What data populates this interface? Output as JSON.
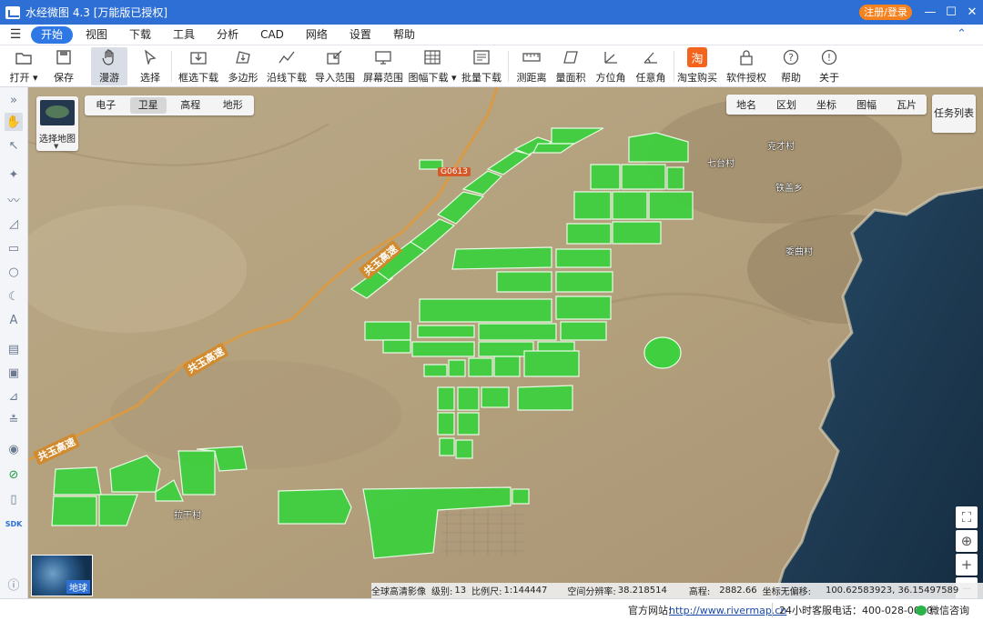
{
  "app": {
    "title": "水经微图 4.3 [万能版已授权]",
    "login_label": "注册/登录",
    "minimize": "—",
    "maximize": "☐",
    "close": "✕"
  },
  "menu": {
    "items": [
      "开始",
      "视图",
      "下载",
      "工具",
      "分析",
      "CAD",
      "网络",
      "设置",
      "帮助"
    ],
    "active": "开始"
  },
  "toolbar": {
    "items": [
      {
        "label": "打开 ▾",
        "icon": "folder-icon"
      },
      {
        "label": "保存",
        "icon": "save-icon"
      },
      {
        "label": "漫游",
        "icon": "hand-icon"
      },
      {
        "label": "选择",
        "icon": "pointer-icon"
      },
      {
        "label": "框选下载",
        "icon": "box-download-icon"
      },
      {
        "label": "多边形",
        "icon": "polygon-download-icon"
      },
      {
        "label": "沿线下载",
        "icon": "line-download-icon"
      },
      {
        "label": "导入范围",
        "icon": "import-range-icon"
      },
      {
        "label": "屏幕范围",
        "icon": "screen-range-icon"
      },
      {
        "label": "图幅下载 ▾",
        "icon": "sheet-download-icon"
      },
      {
        "label": "批量下载",
        "icon": "batch-download-icon"
      },
      {
        "label": "测距离",
        "icon": "ruler-icon"
      },
      {
        "label": "量面积",
        "icon": "area-icon"
      },
      {
        "label": "方位角",
        "icon": "azimuth-icon"
      },
      {
        "label": "任意角",
        "icon": "angle-icon"
      },
      {
        "label": "淘宝购买",
        "icon": "taobao-icon",
        "glyph": "淘"
      },
      {
        "label": "软件授权",
        "icon": "lock-icon"
      },
      {
        "label": "帮助",
        "icon": "help-icon"
      },
      {
        "label": "关于",
        "icon": "info-icon"
      }
    ]
  },
  "leftbar": {
    "items": [
      "collapse-icon",
      "hand-icon",
      "pointer-icon",
      "marker-icon",
      "polyline-icon",
      "area-chart-icon",
      "rectangle-icon",
      "circle-icon",
      "crescent-icon",
      "text-icon",
      "ruler-icon",
      "bus-icon",
      "chart-icon",
      "road-icon",
      "gear-globe-icon",
      "link-icon",
      "phone-icon",
      "sdk-icon",
      "help-icon"
    ],
    "sdk_label": "SDK"
  },
  "map": {
    "type_tabs": [
      "电子",
      "卫星",
      "高程",
      "地形"
    ],
    "active_type": "卫星",
    "select_map_label": "选择地图",
    "layer_tabs": [
      "地名",
      "区划",
      "坐标",
      "图幅",
      "瓦片"
    ],
    "task_list_label": "任务列表",
    "globe_label": "地球",
    "places": [
      "七台村",
      "克才村",
      "铁盖乡",
      "委曲村",
      "拉干村"
    ],
    "road_labels": [
      "共玉高速",
      "共玉高速",
      "共玉高速"
    ],
    "road_badge": "G0613",
    "zoom_buttons": [
      "⛶",
      "⊕",
      "+",
      "−"
    ],
    "status": {
      "source": "全球高清影像",
      "level_label": "级别:",
      "level": "13",
      "scale_label": "比例尺:",
      "scale": "1:144447",
      "resolution_label": "空间分辨率:",
      "resolution": "38.218514",
      "elevation_label": "高程:",
      "elevation": "2882.66",
      "coord_label": "坐标无偏移:",
      "coord": "100.62583923, 36.15497589"
    },
    "colors": {
      "plot_fill": "#3fcf3f",
      "plot_stroke": "#e8ffe8",
      "water": "#1f3d57",
      "road": "#d99a45"
    }
  },
  "statusbar": {
    "site_label": "官方网站:",
    "site_url": "http://www.rivermap.cn",
    "hotline": "24小时客服电话：400-028-0050",
    "wechat": "微信咨询"
  }
}
